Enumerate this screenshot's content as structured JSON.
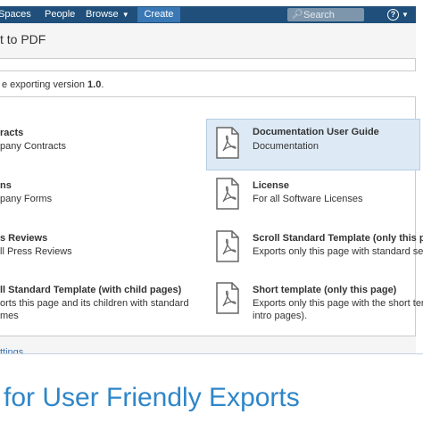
{
  "nav": {
    "items": [
      "Spaces",
      "People",
      "Browse"
    ],
    "create_label": "Create",
    "search_placeholder": "Search",
    "help_symbol": "?",
    "colors": {
      "bar": "#1f4f7a",
      "create": "#3a78b5"
    }
  },
  "dialog": {
    "title": "t to PDF",
    "info_prefix": "e exporting version",
    "info_version": "1.0",
    "info_suffix": ".",
    "templates": [
      {
        "title": "racts",
        "desc": [
          "pany Contracts"
        ],
        "icon": false,
        "selected": false
      },
      {
        "title": "Documentation User Guide",
        "desc": [
          "Documentation"
        ],
        "icon": "pdf-icon",
        "selected": true
      },
      {
        "title": "ns",
        "desc": [
          "pany Forms"
        ],
        "icon": false,
        "selected": false
      },
      {
        "title": "License",
        "desc": [
          "For all Software Licenses"
        ],
        "icon": "pdf-icon",
        "selected": false
      },
      {
        "title": "s Reviews",
        "desc": [
          "ll Press Reviews"
        ],
        "icon": false,
        "selected": false
      },
      {
        "title": "Scroll Standard Template (only this page",
        "desc": [
          "Exports only this page with standard setting"
        ],
        "icon": "pdf-icon",
        "selected": false
      },
      {
        "title": "ll Standard Template (with child pages)",
        "desc": [
          "orts this page and its children with standard",
          "mes"
        ],
        "icon": false,
        "selected": false
      },
      {
        "title": "Short template (only this page)",
        "desc": [
          "Exports only this page with the short templa",
          "intro pages)."
        ],
        "icon": "pdf-icon",
        "selected": false
      }
    ],
    "footer_link": "ttings"
  },
  "caption": {
    "text": "for User Friendly Exports",
    "color": "#2f86c8"
  }
}
